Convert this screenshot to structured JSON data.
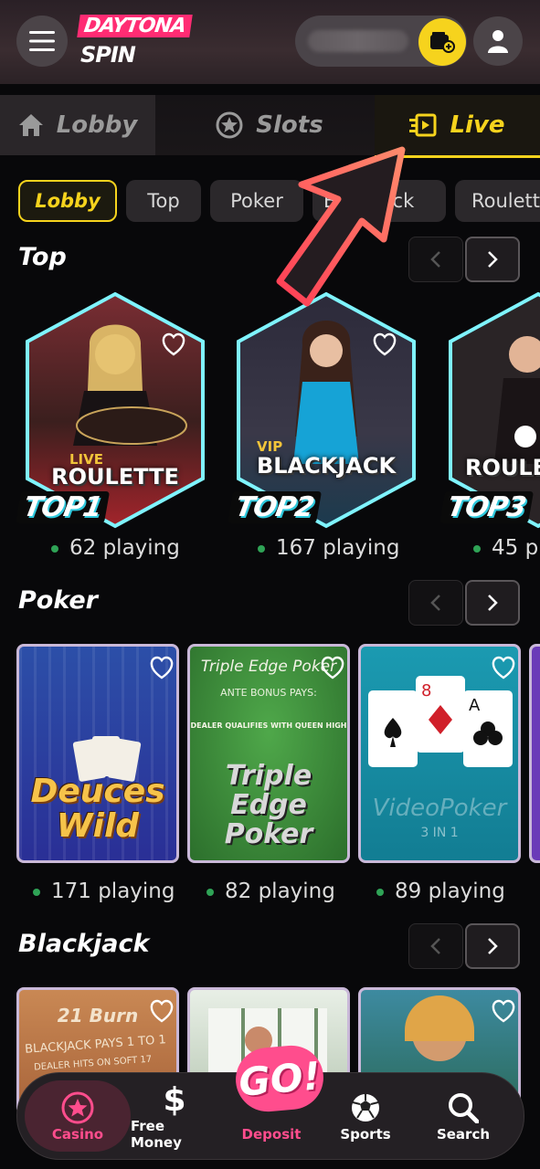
{
  "header": {
    "logo_top": "DAYTONA",
    "logo_bottom": "SPIN",
    "icons": {
      "menu": "hamburger-icon",
      "wallet": "wallet-plus-icon",
      "profile": "user-icon"
    }
  },
  "main_tabs": [
    {
      "label": "Lobby",
      "icon": "home-icon"
    },
    {
      "label": "Slots",
      "icon": "star-icon"
    },
    {
      "label": "Live",
      "icon": "live-icon",
      "active": true
    }
  ],
  "chips": [
    "Lobby",
    "Top",
    "Poker",
    "Blackjack",
    "Roulette"
  ],
  "sections": {
    "top": {
      "title": "Top",
      "games": [
        {
          "name": "ROULETTE",
          "sub": "LIVE",
          "badge": "TOP1",
          "playing": "62 playing"
        },
        {
          "name": "BLACKJACK",
          "sub": "VIP",
          "badge": "TOP2",
          "playing": "167 playing"
        },
        {
          "name": "ROULE",
          "sub": "",
          "badge": "TOP3",
          "playing": "45 p"
        }
      ]
    },
    "poker": {
      "title": "Poker",
      "games": [
        {
          "name": "Deuces Wild",
          "playing": "171 playing"
        },
        {
          "name": "Triple Edge Poker",
          "line1": "Triple Edge Poker",
          "line2": "ANTE BONUS PAYS:",
          "line3": "DEALER QUALIFIES WITH QUEEN HIGH",
          "playing": "82 playing"
        },
        {
          "name": "VideoPoker",
          "line1": "3 IN 1",
          "playing": "89 playing"
        }
      ]
    },
    "blackjack": {
      "title": "Blackjack",
      "games": [
        {
          "name": "21 Burn",
          "line1": "BLACKJACK PAYS 1 TO 1",
          "line2": "DEALER HITS ON SOFT 17"
        }
      ]
    }
  },
  "bottom_nav": [
    {
      "label": "Casino",
      "icon": "star-circle-icon",
      "active": true
    },
    {
      "label": "Free Money",
      "icon": "dollar-icon"
    },
    {
      "label": "Deposit",
      "icon": "go-icon",
      "badge": "GO!"
    },
    {
      "label": "Sports",
      "icon": "soccer-ball-icon"
    },
    {
      "label": "Search",
      "icon": "search-icon"
    }
  ],
  "colors": {
    "accent": "#f6d31d",
    "brand": "#ff2c73",
    "deposit": "#ff4d8d",
    "online_dot": "#2fa356"
  }
}
